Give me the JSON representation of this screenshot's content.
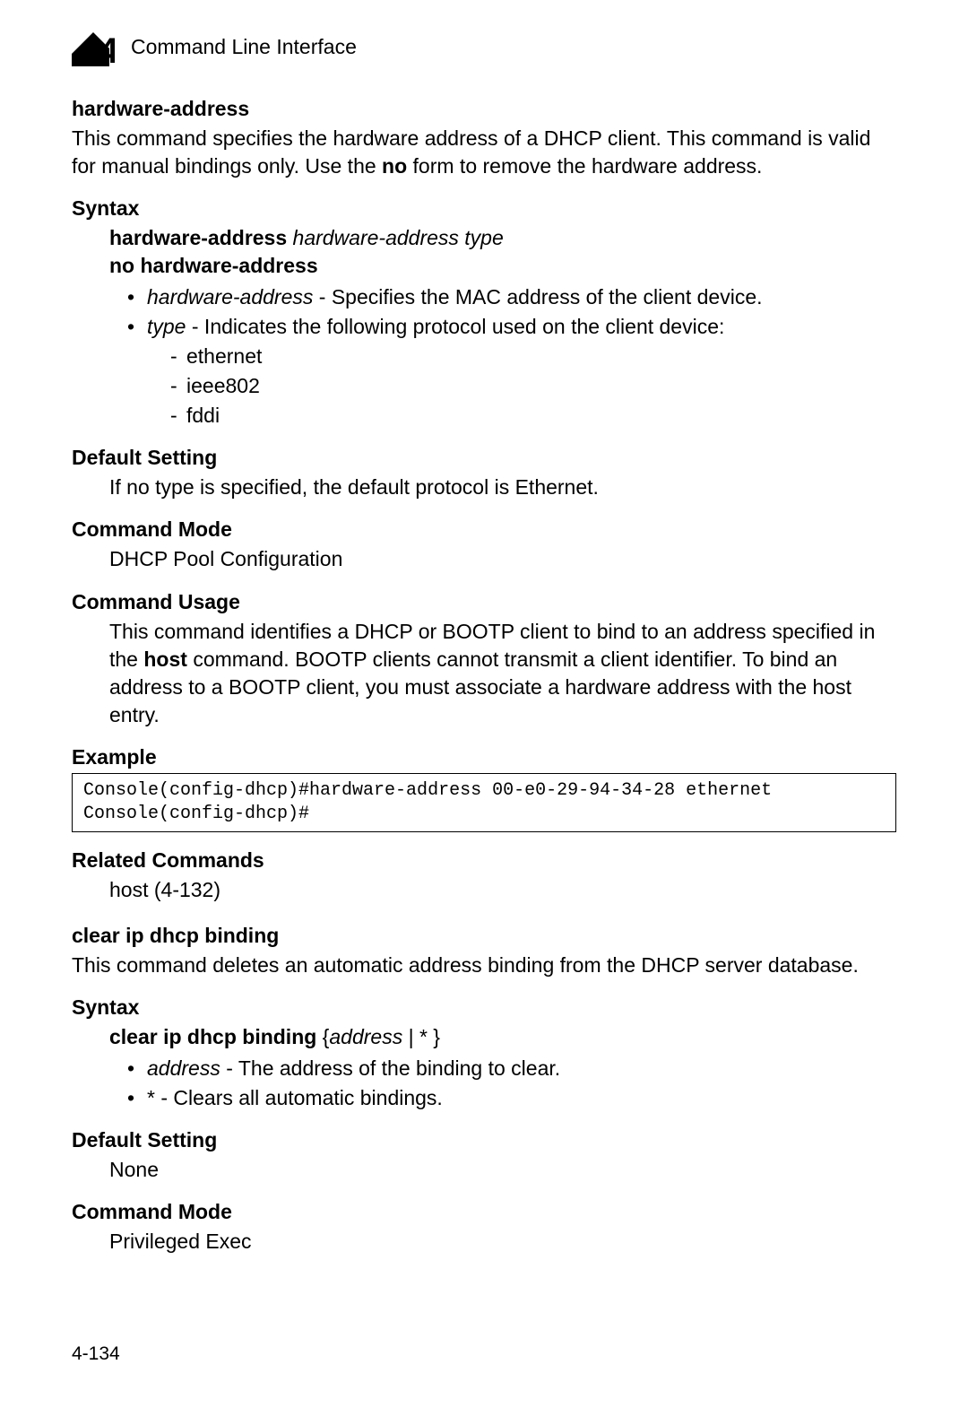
{
  "header": {
    "chapter_number": "4",
    "chapter_title": "Command Line Interface"
  },
  "cmd1": {
    "title": "hardware-address",
    "desc_pre": "This command specifies the hardware address of a DHCP client. This command is valid for manual bindings only. Use the ",
    "desc_bold": "no",
    "desc_post": " form to remove the hardware address.",
    "syntax_head": "Syntax",
    "syntax_l1_b1": "hardware-address",
    "syntax_l1_i": " hardware-address type",
    "syntax_l2_b": "no hardware-address",
    "param1_i": "hardware-address",
    "param1_rest": " - Specifies the MAC address of the client device.",
    "param2_i": "type",
    "param2_rest": " - Indicates the following protocol used on the client device:",
    "t1": "ethernet",
    "t2": "ieee802",
    "t3": "fddi",
    "default_head": "Default Setting",
    "default_body": "If no type is specified, the default protocol is Ethernet.",
    "mode_head": "Command Mode",
    "mode_body": "DHCP Pool Configuration",
    "usage_head": "Command Usage",
    "usage_pre": "This command identifies a DHCP or BOOTP client to bind to an address specified in the ",
    "usage_bold": "host",
    "usage_post": " command. BOOTP clients cannot transmit a client identifier. To bind an address to a BOOTP client, you must associate a hardware address with the host entry.",
    "example_head": "Example",
    "example_code": "Console(config-dhcp)#hardware-address 00-e0-29-94-34-28 ethernet\nConsole(config-dhcp)#",
    "related_head": "Related Commands",
    "related_body": "host (4-132)"
  },
  "cmd2": {
    "title": "clear ip dhcp binding",
    "desc": "This command deletes an automatic address binding from the DHCP server database.",
    "syntax_head": "Syntax",
    "syntax_b1": "clear ip dhcp binding",
    "syntax_mid": " {",
    "syntax_i": "address",
    "syntax_end": " | * }",
    "param1_i": "address",
    "param1_rest": " - The address of the binding to clear.",
    "param2_b": "*",
    "param2_rest": " - Clears all automatic bindings.",
    "default_head": "Default Setting",
    "default_body": "None",
    "mode_head": "Command Mode",
    "mode_body": "Privileged Exec"
  },
  "page_number": "4-134"
}
